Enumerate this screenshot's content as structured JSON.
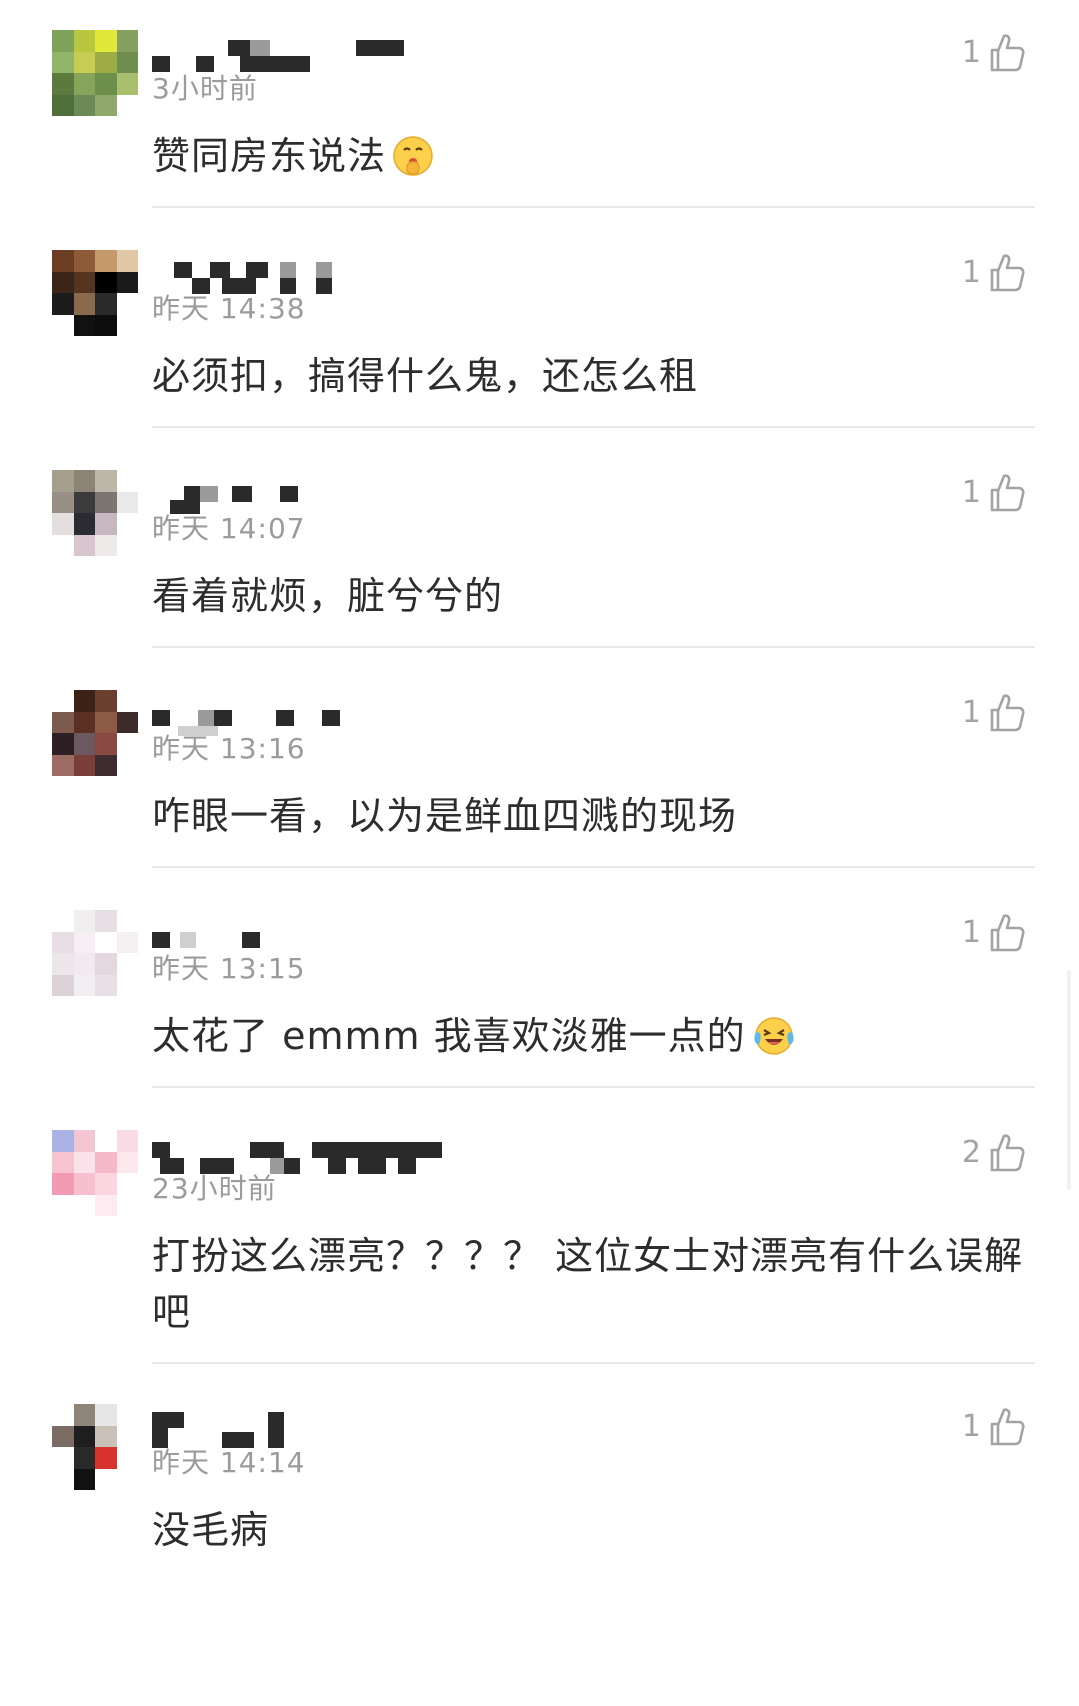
{
  "comments": [
    {
      "time": "3小时前",
      "likes": "1",
      "text": "赞同房东说法",
      "emoji": "shushing-face",
      "avatar": [
        "#7fa25a",
        "#b9c640",
        "#e2e83a",
        "#86a060",
        "#91b66a",
        "#c7cc52",
        "#9cab44",
        "#6f8d4e",
        "#5d7a3e",
        "#86a45a",
        "#6d8f4c",
        "#a8c06e",
        "#4e6e3a",
        "#6c8a58",
        "#90a86a",
        "#ffffff"
      ]
    },
    {
      "time": "昨天 14:38",
      "likes": "1",
      "text": "必须扣，搞得什么鬼，还怎么租",
      "emoji": "",
      "avatar": [
        "#6b3d22",
        "#8e5a38",
        "#c49a6a",
        "#e0c8a6",
        "#3b2518",
        "#55351f",
        "#000000",
        "#1a1a1a",
        "#1c1c1c",
        "#8a6a4c",
        "#2a2a2a",
        "#ffffff",
        "#ffffff",
        "#111111",
        "#0d0d0d",
        "#ffffff"
      ]
    },
    {
      "time": "昨天 14:07",
      "likes": "1",
      "text": "看着就烦，脏兮兮的",
      "emoji": "",
      "avatar": [
        "#a59f8e",
        "#8c8576",
        "#bdb7a7",
        "#ffffff",
        "#9a8f86",
        "#3b3b3e",
        "#7b7672",
        "#e9e9e9",
        "#e4dede",
        "#2b2b33",
        "#c6b7c0",
        "#ffffff",
        "#ffffff",
        "#d7c6ce",
        "#efeaea",
        "#ffffff"
      ]
    },
    {
      "time": "昨天 13:16",
      "likes": "1",
      "text": "咋眼一看，以为是鲜血四溅的现场",
      "emoji": "",
      "avatar": [
        "#ffffff",
        "#3a2216",
        "#6b3f2e",
        "#ffffff",
        "#7c5a4c",
        "#5a2f24",
        "#8d5a46",
        "#3b2c2b",
        "#2d1f24",
        "#6c5860",
        "#8a4a42",
        "#ffffff",
        "#9c6b62",
        "#7a3e38",
        "#3f2c2f",
        "#ffffff"
      ]
    },
    {
      "time": "昨天 13:15",
      "likes": "1",
      "text": "太花了 emmm  我喜欢淡雅一点的",
      "emoji": "laughing-crying-face",
      "avatar": [
        "#ffffff",
        "#f1eef0",
        "#e6e0e4",
        "#ffffff",
        "#e8dde5",
        "#f6eef2",
        "#ffffff",
        "#f4f0f2",
        "#ece6ea",
        "#f2eaee",
        "#e4d8de",
        "#ffffff",
        "#dcd2d8",
        "#f3eef1",
        "#e8e0e6",
        "#ffffff"
      ]
    },
    {
      "time": "23小时前",
      "likes": "2",
      "text": "打扮这么漂亮？？？？ 这位女士对漂亮有什么误解吧",
      "emoji": "",
      "avatar": [
        "#aab2e6",
        "#f4c6d4",
        "#ffffff",
        "#f9dbe4",
        "#f6c3d1",
        "#fbe2ea",
        "#f5b9c9",
        "#fde8ee",
        "#f39bb2",
        "#f7c0cf",
        "#fbd5df",
        "#ffffff",
        "#ffffff",
        "#ffffff",
        "#fcebf0",
        "#ffffff"
      ]
    },
    {
      "time": "昨天 14:14",
      "likes": "1",
      "text": "没毛病",
      "emoji": "",
      "avatar": [
        "#ffffff",
        "#8f8478",
        "#e6e6e6",
        "#ffffff",
        "#7a6c62",
        "#1e1e1e",
        "#c9c0b8",
        "#ffffff",
        "#ffffff",
        "#2a2a2a",
        "#d8322d",
        "#ffffff",
        "#ffffff",
        "#111111",
        "#ffffff",
        "#ffffff"
      ]
    }
  ],
  "colors": {
    "text": "#2d2d2d",
    "meta": "#9b9b9b",
    "divider": "#e8e8e8",
    "like_icon": "#a3a3a3"
  }
}
